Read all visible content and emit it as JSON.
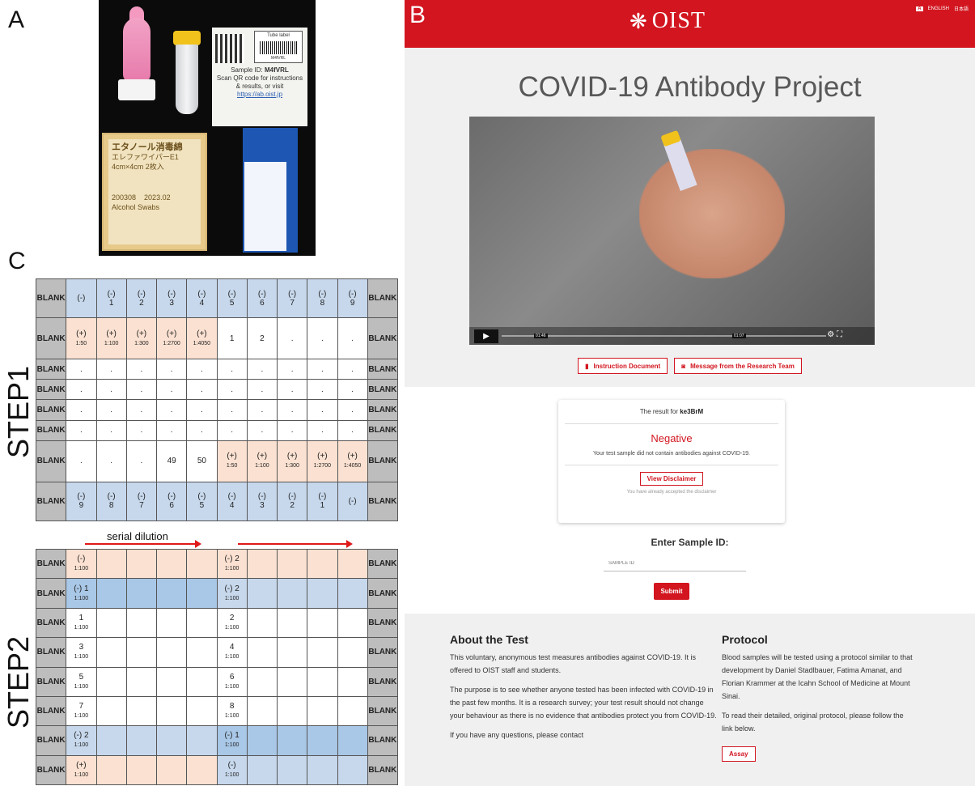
{
  "panels": {
    "a": "A",
    "b": "B",
    "c": "C"
  },
  "kit": {
    "tube_label_title": "Tube label",
    "tube_label_code": "M4fVRL",
    "sample_id_prefix": "Sample ID: ",
    "sample_id": "M4fVRL",
    "instructions": "Scan QR code for instructions & results, or visit",
    "url": "https://ab.oist.jp",
    "wipe_title": "エタノール消毒綿",
    "wipe_sub": "エレファワイパーE1",
    "wipe_size": "4cm×4cm 2枚入",
    "wipe_lot": "200308",
    "wipe_exp": "2023.02",
    "wipe_brand": "Alcohol Swabs"
  },
  "site": {
    "logo_text": "OIST",
    "lang": [
      "A",
      "ENGLISH",
      "日本語"
    ],
    "title": "COVID-19 Antibody Project",
    "video_time_current": "01:46",
    "video_time_hover": "01:07",
    "btn_instruction": "Instruction Document",
    "btn_message": "Message from the Research Team",
    "result_prefix": "The result for ",
    "result_id": "ke3BrM",
    "result_value": "Negative",
    "result_desc": "Your test sample did not contain antibodies against COVID-19.",
    "btn_disclaimer": "View Disclaimer",
    "disclaimer_note": "You have already accepted the disclaimer",
    "enter_label": "Enter Sample ID:",
    "input_placeholder": "SAMPLE ID",
    "btn_submit": "Submit",
    "about_title": "About the Test",
    "about_p1": "This voluntary, anonymous test measures antibodies against COVID-19. It is offered to OIST staff and students.",
    "about_p2": "The purpose is to see whether anyone tested has been infected with COVID-19 in the past few months. It is a research survey; your test result should not change your behaviour as there is no evidence that antibodies protect you from COVID-19.",
    "about_p3": "If you have any questions, please contact",
    "protocol_title": "Protocol",
    "protocol_p1": "Blood samples will be tested using a protocol similar to that development by Daniel Stadlbauer, Fatima Amanat, and Florian Krammer at the Icahn School of Medicine at Mount Sinai.",
    "protocol_p2": "To read their detailed, original protocol, please follow the link below.",
    "btn_assay": "Assay"
  },
  "plates": {
    "step1_label": "STEP1",
    "step2_label": "STEP2",
    "serial_label": "serial dilution",
    "blank": "BLANK",
    "step1_rows": [
      [
        {
          "t": "(-)",
          "c": "blue"
        },
        {
          "t": "(-)\n1",
          "c": "blue"
        },
        {
          "t": "(-)\n2",
          "c": "blue"
        },
        {
          "t": "(-)\n3",
          "c": "blue"
        },
        {
          "t": "(-)\n4",
          "c": "blue"
        },
        {
          "t": "(-)\n5",
          "c": "blue"
        },
        {
          "t": "(-)\n6",
          "c": "blue"
        },
        {
          "t": "(-)\n7",
          "c": "blue"
        },
        {
          "t": "(-)\n8",
          "c": "blue"
        },
        {
          "t": "(-)\n9",
          "c": "blue"
        }
      ],
      [
        {
          "t": "(+)\n1:50",
          "c": "orange"
        },
        {
          "t": "(+)\n1:100",
          "c": "orange"
        },
        {
          "t": "(+)\n1:300",
          "c": "orange"
        },
        {
          "t": "(+)\n1:2700",
          "c": "orange"
        },
        {
          "t": "(+)\n1:4050",
          "c": "orange"
        },
        {
          "t": "1",
          "c": ""
        },
        {
          "t": "2",
          "c": ""
        },
        {
          "t": ".",
          "c": ""
        },
        {
          "t": ".",
          "c": ""
        },
        {
          "t": ".",
          "c": ""
        }
      ],
      [
        {
          "t": ".",
          "c": ""
        },
        {
          "t": ".",
          "c": ""
        },
        {
          "t": ".",
          "c": ""
        },
        {
          "t": ".",
          "c": ""
        },
        {
          "t": ".",
          "c": ""
        },
        {
          "t": ".",
          "c": ""
        },
        {
          "t": ".",
          "c": ""
        },
        {
          "t": ".",
          "c": ""
        },
        {
          "t": ".",
          "c": ""
        },
        {
          "t": ".",
          "c": ""
        }
      ],
      [
        {
          "t": ".",
          "c": ""
        },
        {
          "t": ".",
          "c": ""
        },
        {
          "t": ".",
          "c": ""
        },
        {
          "t": ".",
          "c": ""
        },
        {
          "t": ".",
          "c": ""
        },
        {
          "t": ".",
          "c": ""
        },
        {
          "t": ".",
          "c": ""
        },
        {
          "t": ".",
          "c": ""
        },
        {
          "t": ".",
          "c": ""
        },
        {
          "t": ".",
          "c": ""
        }
      ],
      [
        {
          "t": ".",
          "c": ""
        },
        {
          "t": ".",
          "c": ""
        },
        {
          "t": ".",
          "c": ""
        },
        {
          "t": ".",
          "c": ""
        },
        {
          "t": ".",
          "c": ""
        },
        {
          "t": ".",
          "c": ""
        },
        {
          "t": ".",
          "c": ""
        },
        {
          "t": ".",
          "c": ""
        },
        {
          "t": ".",
          "c": ""
        },
        {
          "t": ".",
          "c": ""
        }
      ],
      [
        {
          "t": ".",
          "c": ""
        },
        {
          "t": ".",
          "c": ""
        },
        {
          "t": ".",
          "c": ""
        },
        {
          "t": ".",
          "c": ""
        },
        {
          "t": ".",
          "c": ""
        },
        {
          "t": ".",
          "c": ""
        },
        {
          "t": ".",
          "c": ""
        },
        {
          "t": ".",
          "c": ""
        },
        {
          "t": ".",
          "c": ""
        },
        {
          "t": ".",
          "c": ""
        }
      ],
      [
        {
          "t": ".",
          "c": ""
        },
        {
          "t": ".",
          "c": ""
        },
        {
          "t": ".",
          "c": ""
        },
        {
          "t": "49",
          "c": ""
        },
        {
          "t": "50",
          "c": ""
        },
        {
          "t": "(+)\n1:50",
          "c": "orange"
        },
        {
          "t": "(+)\n1:100",
          "c": "orange"
        },
        {
          "t": "(+)\n1:300",
          "c": "orange"
        },
        {
          "t": "(+)\n1:2700",
          "c": "orange"
        },
        {
          "t": "(+)\n1:4050",
          "c": "orange"
        }
      ],
      [
        {
          "t": "(-)\n9",
          "c": "blue"
        },
        {
          "t": "(-)\n8",
          "c": "blue"
        },
        {
          "t": "(-)\n7",
          "c": "blue"
        },
        {
          "t": "(-)\n6",
          "c": "blue"
        },
        {
          "t": "(-)\n5",
          "c": "blue"
        },
        {
          "t": "(-)\n4",
          "c": "blue"
        },
        {
          "t": "(-)\n3",
          "c": "blue"
        },
        {
          "t": "(-)\n2",
          "c": "blue"
        },
        {
          "t": "(-)\n1",
          "c": "blue"
        },
        {
          "t": "(-)",
          "c": "blue"
        }
      ]
    ],
    "step2_rows": [
      {
        "a": "(-)\n1:100",
        "b": "(-) 2\n1:100",
        "ca": "orange",
        "cb": "orange"
      },
      {
        "a": "(-) 1\n1:100",
        "b": "(-) 2\n1:100",
        "ca": "dblue",
        "cb": "blue"
      },
      {
        "a": "1\n1:100",
        "b": "2\n1:100",
        "ca": "",
        "cb": ""
      },
      {
        "a": "3\n1:100",
        "b": "4\n1:100",
        "ca": "",
        "cb": ""
      },
      {
        "a": "5\n1:100",
        "b": "6\n1:100",
        "ca": "",
        "cb": ""
      },
      {
        "a": "7\n1:100",
        "b": "8\n1:100",
        "ca": "",
        "cb": ""
      },
      {
        "a": "(-) 2\n1:100",
        "b": "(-) 1\n1:100",
        "ca": "blue",
        "cb": "dblue"
      },
      {
        "a": "(+)\n1:100",
        "b": "(-)\n1:100",
        "ca": "orange",
        "cb": "blue"
      }
    ]
  }
}
